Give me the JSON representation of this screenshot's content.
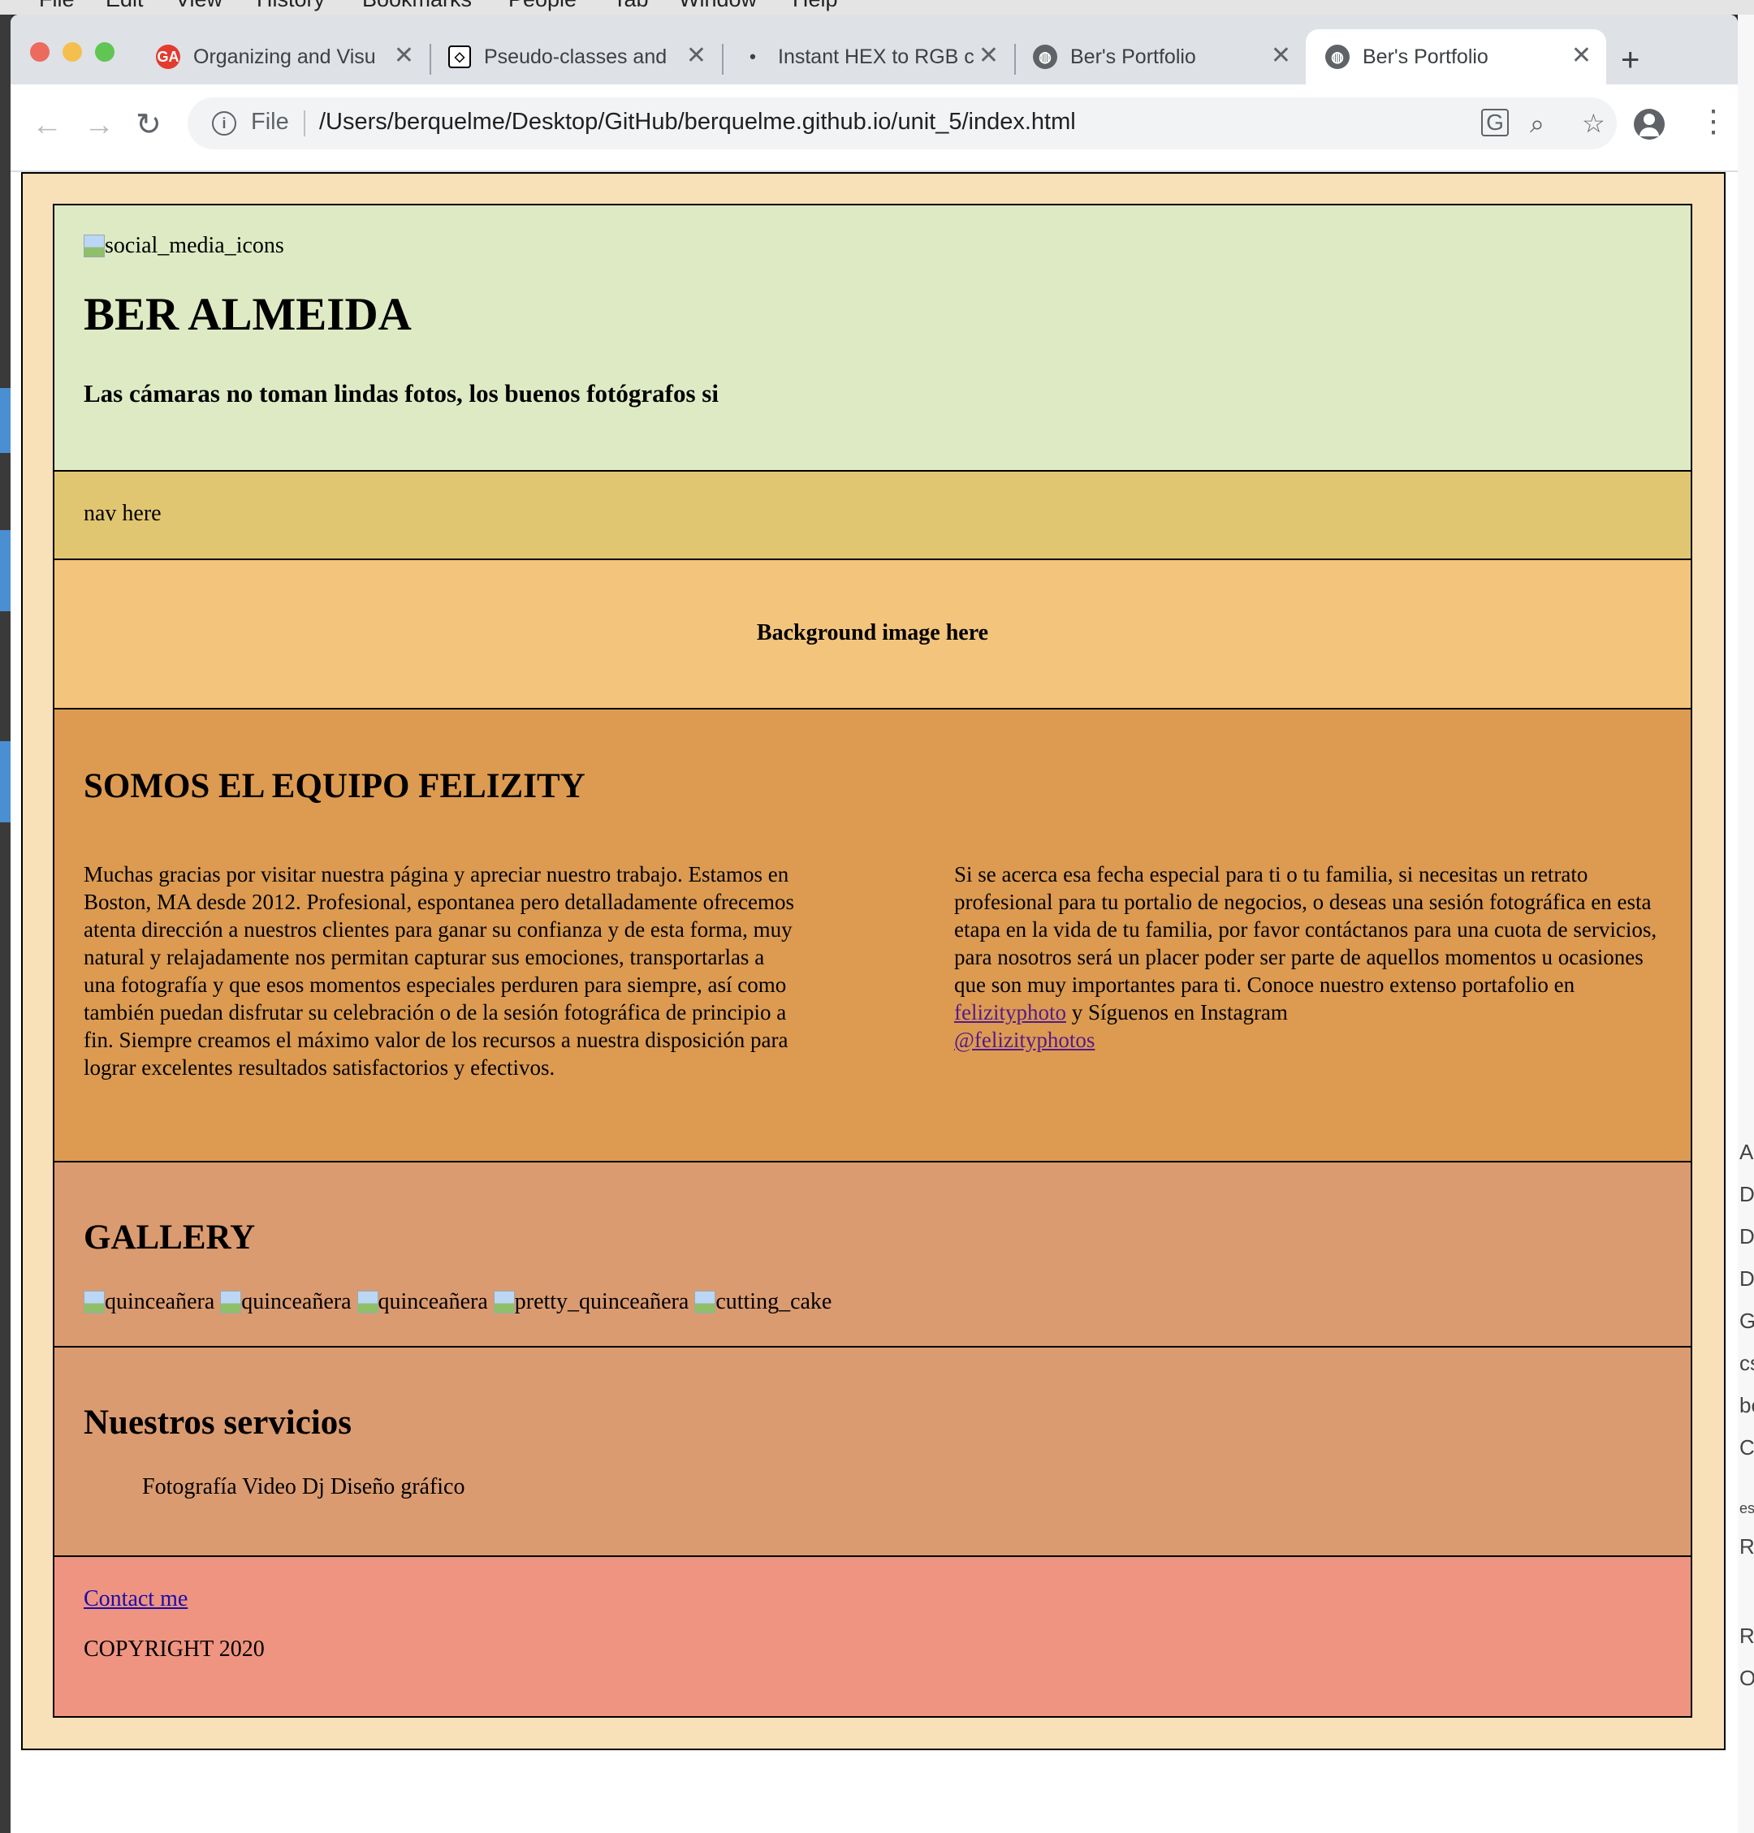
{
  "os_menu": [
    "File",
    "Edit",
    "View",
    "History",
    "Bookmarks",
    "People",
    "Tab",
    "Window",
    "Help"
  ],
  "right_strip": [
    "Ap",
    "D",
    "D",
    "D",
    "G",
    "cs",
    "be",
    "C",
    "es",
    "Re",
    "Re",
    "O"
  ],
  "browser": {
    "tabs": [
      {
        "title": "Organizing and Visu",
        "favicon": "ga-logo-icon",
        "active": false
      },
      {
        "title": "Pseudo-classes and",
        "favicon": "codepen-icon",
        "active": false
      },
      {
        "title": "Instant HEX to RGB c",
        "favicon": "dot-icon",
        "active": false
      },
      {
        "title": "Ber's Portfolio",
        "favicon": "globe-icon",
        "active": false
      },
      {
        "title": "Ber's Portfolio",
        "favicon": "globe-icon",
        "active": true
      }
    ],
    "address": {
      "scheme": "File",
      "url": "/Users/berquelme/Desktop/GitHub/berquelme.github.io/unit_5/index.html"
    }
  },
  "page": {
    "header": {
      "icons_alt": "social_media_icons",
      "title": "BER ALMEIDA",
      "tagline": "Las cámaras no toman lindas fotos, los buenos fotógrafos si"
    },
    "nav": {
      "text": "nav here"
    },
    "hero": {
      "text": "Background image here"
    },
    "about": {
      "heading": "SOMOS EL EQUIPO FELIZITY",
      "left_text": "Muchas gracias por visitar nuestra página y apreciar nuestro trabajo. Estamos en Boston, MA desde 2012. Profesional, espontanea pero detalladamente ofrecemos atenta dirección a nuestros clientes para ganar su confianza y de esta forma, muy natural y relajadamente nos permitan capturar sus emociones, transportarlas a una fotografía y que esos momentos especiales perduren para siempre, así como también puedan disfrutar su celebración o de la sesión fotográfica de principio a fin. Siempre creamos el máximo valor de los recursos a nuestra disposición para lograr excelentes resultados satisfactorios y efectivos.",
      "right_text_1": "Si se acerca esa fecha especial para ti o tu familia, si necesitas un retrato profesional para tu portalio de negocios, o deseas una sesión fotográfica en esta etapa en la vida de tu familia, por favor contáctanos para una cuota de servicios, para nosotros será un placer poder ser parte de aquellos momentos u ocasiones que son muy importantes para ti. Conoce nuestro extenso portafolio en",
      "link_1": "felizityphoto",
      "right_text_2": "y Síguenos en Instagram",
      "link_2": "@felizityphotos"
    },
    "gallery": {
      "heading": "GALLERY",
      "images_alt": [
        "quinceañera",
        "quinceañera",
        "quinceañera",
        "pretty_quinceañera",
        "cutting_cake"
      ]
    },
    "services": {
      "heading": "Nuestros servicios",
      "list": "Fotografía Video Dj Diseño gráfico"
    },
    "footer": {
      "contact": "Contact me",
      "copyright": "COPYRIGHT 2020"
    }
  },
  "colors": {
    "outer_bg": "#f8e0b8",
    "header_bg": "#deeac3",
    "nav_bg": "#e1c672",
    "hero_bg": "#f3c47c",
    "about_bg": "#dc9b51",
    "gallery_bg": "#db9b70",
    "services_bg": "#db9b70",
    "footer_bg": "#ee9480"
  }
}
